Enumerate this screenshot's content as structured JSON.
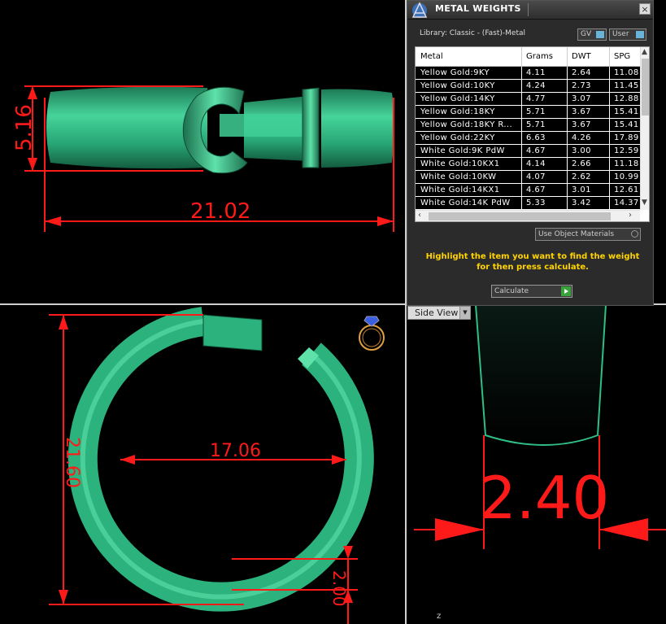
{
  "panel": {
    "title": "METAL WEIGHTS",
    "close_label": "×",
    "library_label": "Library: Classic - (Fast)-Metal",
    "gv_label": "GV",
    "user_label": "User",
    "columns": [
      "Metal",
      "Grams",
      "DWT",
      "SPG"
    ],
    "rows": [
      {
        "metal": "Yellow Gold:9KY",
        "grams": "4.11",
        "dwt": "2.64",
        "spg": "11.08"
      },
      {
        "metal": "Yellow Gold:10KY",
        "grams": "4.24",
        "dwt": "2.73",
        "spg": "11.45"
      },
      {
        "metal": "Yellow Gold:14KY",
        "grams": "4.77",
        "dwt": "3.07",
        "spg": "12.88"
      },
      {
        "metal": "Yellow Gold:18KY",
        "grams": "5.71",
        "dwt": "3.67",
        "spg": "15.41"
      },
      {
        "metal": "Yellow Gold:18KY R...",
        "grams": "5.71",
        "dwt": "3.67",
        "spg": "15.41"
      },
      {
        "metal": "Yellow Gold:22KY",
        "grams": "6.63",
        "dwt": "4.26",
        "spg": "17.89"
      },
      {
        "metal": "White Gold:9K PdW",
        "grams": "4.67",
        "dwt": "3.00",
        "spg": "12.59"
      },
      {
        "metal": "White Gold:10KX1",
        "grams": "4.14",
        "dwt": "2.66",
        "spg": "11.18"
      },
      {
        "metal": "White Gold:10KW",
        "grams": "4.07",
        "dwt": "2.62",
        "spg": "10.99"
      },
      {
        "metal": "White Gold:14KX1",
        "grams": "4.67",
        "dwt": "3.01",
        "spg": "12.61"
      },
      {
        "metal": "White Gold:14K PdW",
        "grams": "5.33",
        "dwt": "3.42",
        "spg": "14.37"
      }
    ],
    "use_object_materials_label": "Use Object Materials",
    "hint": "Highlight the item you want to find the weight for then press calculate.",
    "calculate_label": "Calculate"
  },
  "viewports": {
    "front": {
      "height_dim": "5.16",
      "width_dim": "21.02"
    },
    "top": {
      "inner_dim": "17.06",
      "outer_dim": "21.60",
      "thickness_dim": "2.00"
    },
    "side": {
      "view_label": "Side View",
      "thickness_dim": "2.40",
      "axis_label": "z"
    }
  },
  "colors": {
    "band": "#2fbf86",
    "dimension": "#ff1a1a",
    "hint": "#ffd400"
  }
}
